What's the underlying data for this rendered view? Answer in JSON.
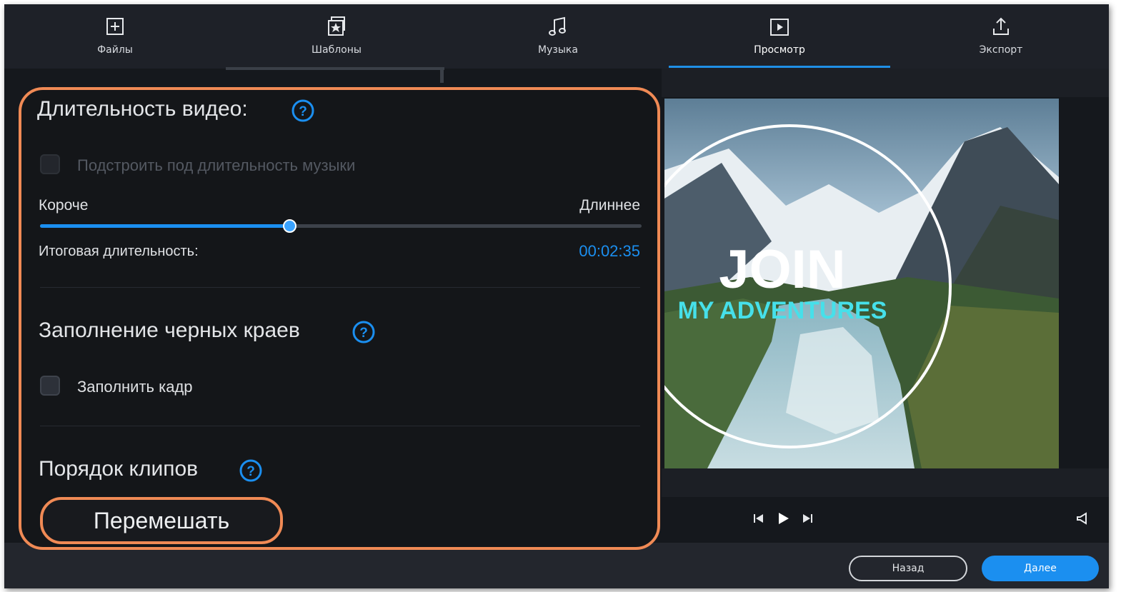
{
  "tabs": [
    {
      "label": "Файлы",
      "icon": "add-file-icon"
    },
    {
      "label": "Шаблоны",
      "icon": "templates-icon"
    },
    {
      "label": "Музыка",
      "icon": "music-icon"
    },
    {
      "label": "Просмотр",
      "icon": "play-preview-icon",
      "active": true
    },
    {
      "label": "Экспорт",
      "icon": "export-icon"
    }
  ],
  "panel": {
    "duration_title": "Длительность видео:",
    "fit_music_label": "Подстроить под длительность музыки",
    "shorter_label": "Короче",
    "longer_label": "Длиннее",
    "slider_value": 0.415,
    "total_label": "Итоговая длительность:",
    "total_value": "00:02:35",
    "fill_title": "Заполнение черных краев",
    "fill_frame_label": "Заполнить кадр",
    "order_title": "Порядок клипов",
    "shuffle_button": "Перемешать"
  },
  "preview": {
    "title_main": "JOIN",
    "title_sub": "MY ADVENTURES"
  },
  "footer": {
    "back_button": "Назад",
    "next_button": "Далее"
  },
  "colors": {
    "accent": "#1b8ff0",
    "highlight": "#f08a55",
    "subtitle": "#46e0ea"
  }
}
